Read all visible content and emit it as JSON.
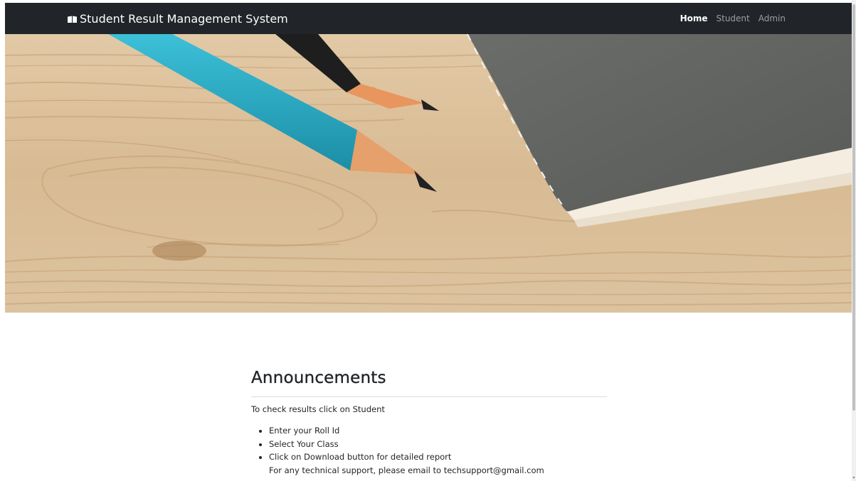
{
  "navbar": {
    "brand_icon": "book-icon",
    "brand": "Student Result Management System",
    "links": [
      {
        "label": "Home",
        "active": true
      },
      {
        "label": "Student",
        "active": false
      },
      {
        "label": "Admin",
        "active": false
      }
    ],
    "background": "#212529"
  },
  "hero": {
    "image": "pencils-and-notebook-on-wooden-desk"
  },
  "announcements": {
    "title": "Announcements",
    "intro": "To check results click on Student",
    "steps": [
      "Enter your Roll Id",
      "Select Your Class",
      "Click on Download button for detailed report"
    ],
    "support": "For any technical support, please email to techsupport@gmail.com"
  }
}
